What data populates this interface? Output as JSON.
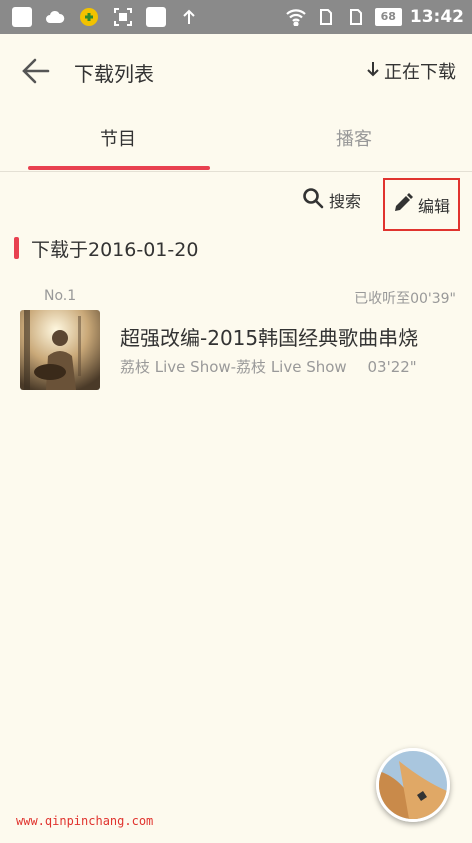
{
  "status_bar": {
    "battery": "68",
    "time": "13:42"
  },
  "header": {
    "title": "下载列表",
    "downloading_label": "正在下载"
  },
  "tabs": [
    {
      "label": "节目",
      "active": true
    },
    {
      "label": "播客",
      "active": false
    }
  ],
  "toolbar": {
    "search_label": "搜索",
    "edit_label": "编辑"
  },
  "section": {
    "title": "下载于2016-01-20"
  },
  "items": [
    {
      "index": "No.1",
      "progress": "已收听至00'39\"",
      "title": "超强改编-2015韩国经典歌曲串烧",
      "source": "荔枝 Live Show-荔枝 Live Show",
      "duration": "03'22\""
    }
  ],
  "watermark": "www.qinpinchang.com",
  "colors": {
    "accent": "#e84150",
    "background": "#fdfaee",
    "status_bar": "#8a8a8a",
    "highlight_box": "#e0332e"
  }
}
